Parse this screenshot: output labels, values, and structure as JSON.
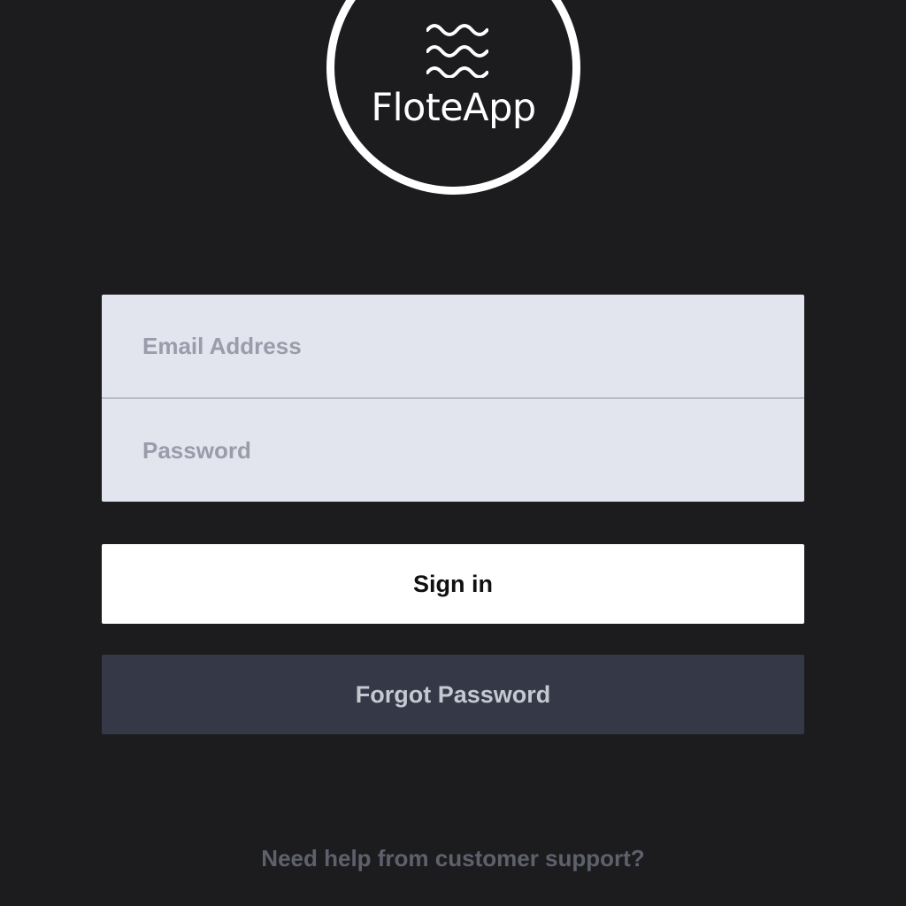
{
  "app": {
    "name": "FloteApp"
  },
  "logo": {
    "icon": "waves-icon",
    "text": "FloteApp"
  },
  "login_form": {
    "email": {
      "placeholder": "Email Address",
      "value": ""
    },
    "password": {
      "placeholder": "Password",
      "value": ""
    }
  },
  "buttons": {
    "sign_in_label": "Sign in",
    "forgot_password_label": "Forgot Password"
  },
  "support": {
    "link_text": "Need help from customer support?"
  },
  "colors": {
    "background": "#1c1c1e",
    "form_background": "#e2e4ee",
    "primary_button": "#ffffff",
    "secondary_button": "#353846",
    "placeholder_text": "#9a9caa",
    "support_text": "#5e616c"
  }
}
